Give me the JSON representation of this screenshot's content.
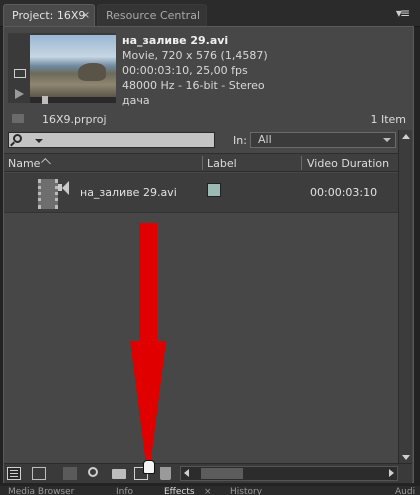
{
  "tabs": {
    "project": "Project: 16X9",
    "close": "×",
    "resource_central": "Resource Central",
    "menu": "▾≡"
  },
  "preview": {
    "title": "на_заливе 29.avi",
    "line1": "Movie, 720 x 576 (1,4587)",
    "line2": "00:00:03:10, 25,00 fps",
    "line3": "48000 Hz - 16-bit - Stereo",
    "line4": "дача"
  },
  "project": {
    "name": "16X9.prproj",
    "count": "1 Item"
  },
  "search": {
    "in_label": "In:",
    "in_value": "All"
  },
  "columns": {
    "name": "Name",
    "label": "Label",
    "duration": "Video Duration"
  },
  "items": [
    {
      "name": "на_заливе 29.avi",
      "label_color": "#9bbab1",
      "duration": "00:00:03:10"
    }
  ],
  "annotation": {
    "arrow_color": "#e00000"
  },
  "bottom_tabs": {
    "media_browser": "Media Browser",
    "info": "Info",
    "effects": "Effects",
    "effects_close": "×",
    "history": "History",
    "audio": "Audi"
  }
}
